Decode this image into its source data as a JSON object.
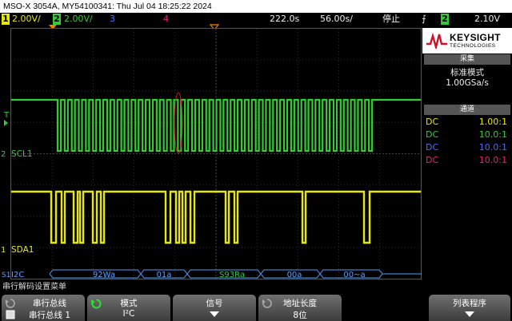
{
  "header": {
    "title": "MSO-X 3054A, MY54100341: Thu Jul 04 18:25:22 2024"
  },
  "topbar": {
    "ch1_num": "1",
    "ch1_scale": "2.00V/",
    "ch2_num": "2",
    "ch2_scale": "2.00V/",
    "ch3_num": "3",
    "ch4_num": "4",
    "delay": "222.0s",
    "timebase": "56.00s/",
    "run_state": "停止",
    "trig_source": "2",
    "trig_level": "2.10V",
    "colors": {
      "ch1": "#e8e800",
      "ch2": "#33cc33",
      "ch3": "#4a6cff",
      "ch4": "#e0207a"
    }
  },
  "brand": {
    "name": "KEYSIGHT",
    "sub": "TECHNOLOGIES"
  },
  "acquisition": {
    "header": "采集",
    "mode": "标准模式",
    "rate": "1.00GSa/s"
  },
  "channels": {
    "header": "通道",
    "probes": [
      {
        "coupling": "DC",
        "ratio": "1.00:1",
        "color": "#e8e800"
      },
      {
        "coupling": "DC",
        "ratio": "10.0:1",
        "color": "#33cc33"
      },
      {
        "coupling": "DC",
        "ratio": "10.0:1",
        "color": "#4a6cff"
      },
      {
        "coupling": "DC",
        "ratio": "10.0:1",
        "color": "#e0207a"
      }
    ]
  },
  "traces": {
    "scl_label": "SCL1",
    "sda_label": "SDA1",
    "t_marker": "T",
    "ch2_marker": "2",
    "ch1_marker": "1"
  },
  "decode": {
    "bus_label": "I2C",
    "bus_prefix": "S1",
    "packets": [
      "92Wa",
      "01a",
      "S93Ra",
      "00a",
      "00~a"
    ]
  },
  "menu": {
    "title": "串行解码设置菜单",
    "softkeys": [
      {
        "line1": "串行总线",
        "line2": "串行总线 1"
      },
      {
        "line1": "模式",
        "line2": "I²C"
      },
      {
        "line1": "信号",
        "line2": ""
      },
      {
        "line1": "地址长度",
        "line2": "8位"
      },
      {
        "line1": "列表程序",
        "line2": ""
      }
    ]
  }
}
